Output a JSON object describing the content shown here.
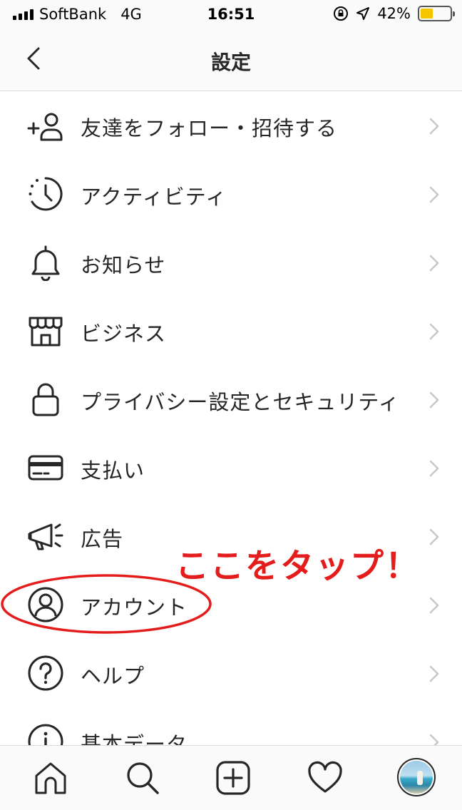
{
  "status_bar": {
    "carrier": "SoftBank",
    "network": "4G",
    "time": "16:51",
    "battery_percent": "42%",
    "battery_level": 0.42,
    "battery_color": "#f5c500"
  },
  "header": {
    "back_icon": "chevron-left-icon",
    "title": "設定"
  },
  "menu": {
    "items": [
      {
        "label": "友達をフォロー・招待する",
        "icon": "add-person-icon"
      },
      {
        "label": "アクティビティ",
        "icon": "activity-clock-icon"
      },
      {
        "label": "お知らせ",
        "icon": "bell-icon"
      },
      {
        "label": "ビジネス",
        "icon": "storefront-icon"
      },
      {
        "label": "プライバシー設定とセキュリティ",
        "icon": "lock-icon"
      },
      {
        "label": "支払い",
        "icon": "credit-card-icon"
      },
      {
        "label": "広告",
        "icon": "megaphone-icon"
      },
      {
        "label": "アカウント",
        "icon": "account-circle-icon"
      },
      {
        "label": "ヘルプ",
        "icon": "help-icon"
      },
      {
        "label": "基本データ",
        "icon": "info-icon"
      }
    ]
  },
  "annotation": {
    "text": "ここをタップ！",
    "color": "#e41c1c"
  },
  "tab_bar": {
    "tabs": [
      "home-icon",
      "search-icon",
      "new-post-icon",
      "heart-icon",
      "profile-avatar"
    ]
  }
}
